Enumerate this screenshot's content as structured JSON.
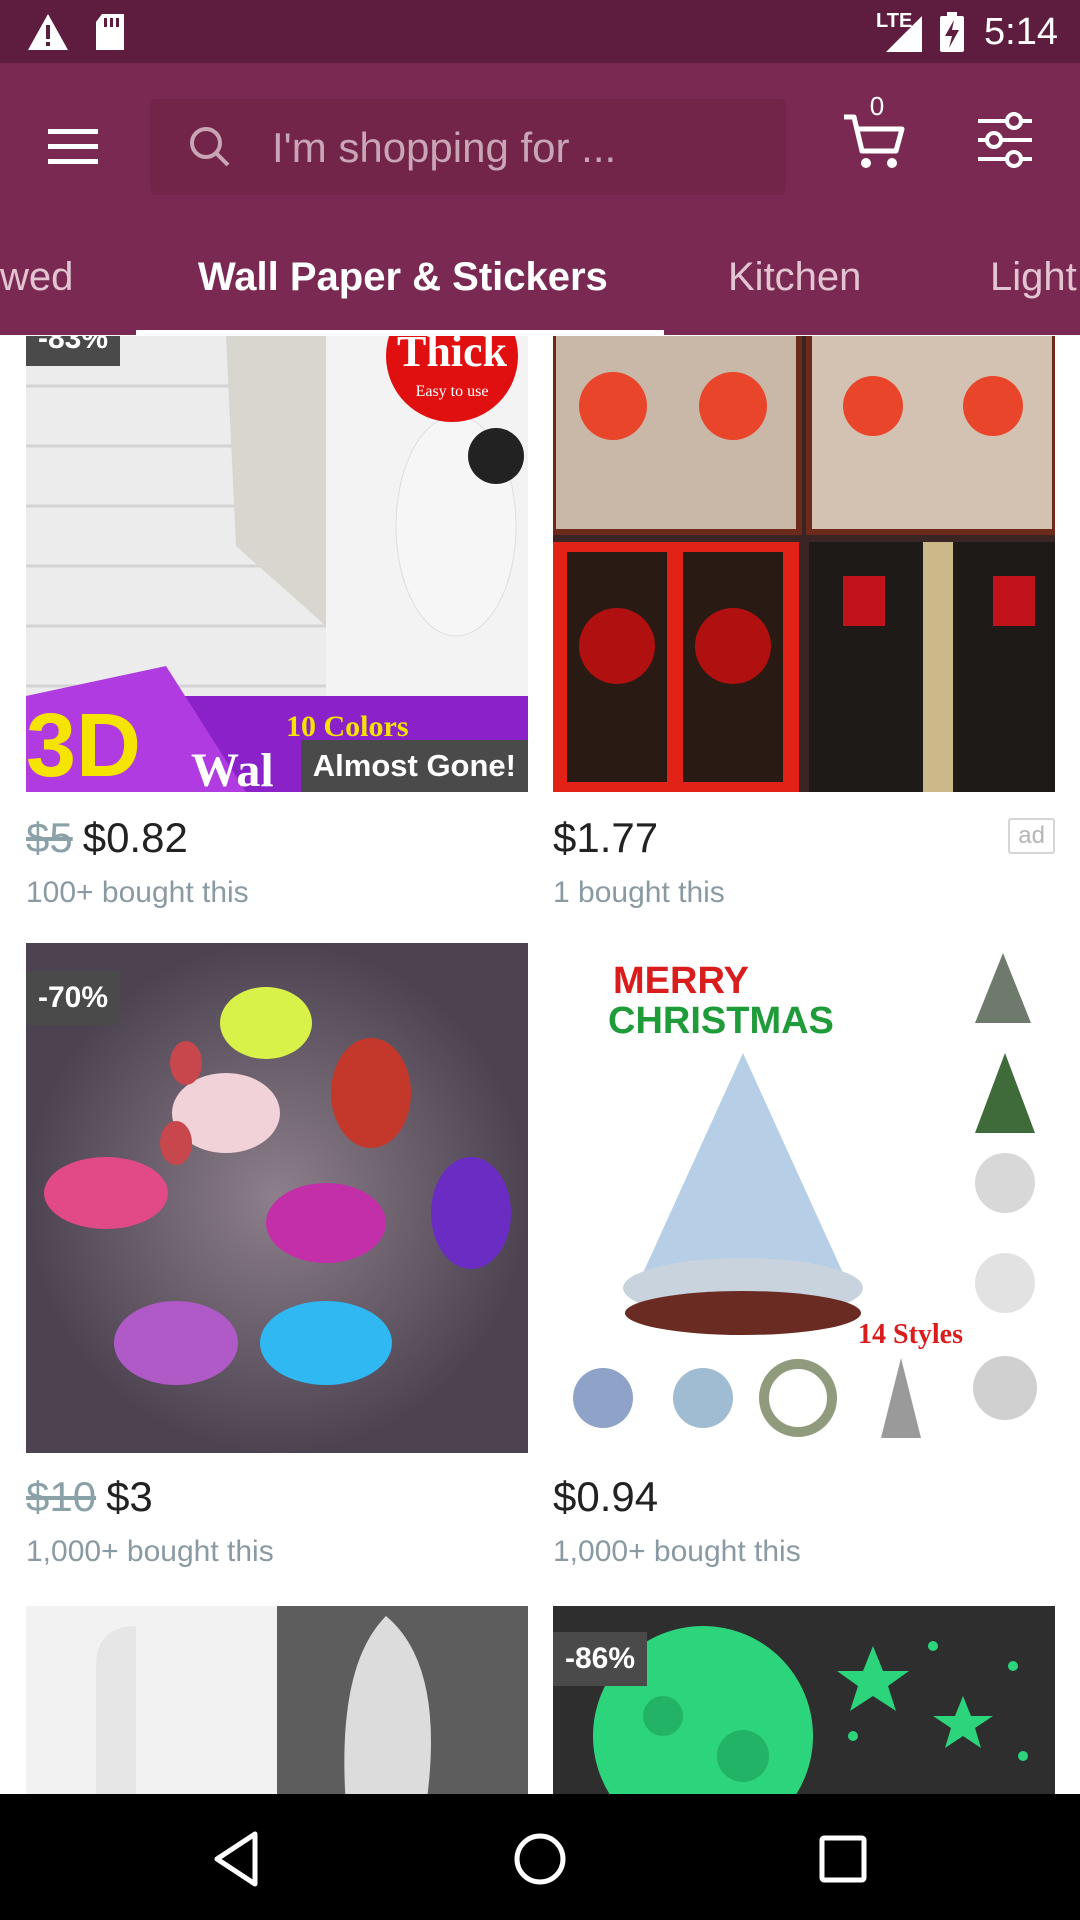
{
  "status_bar": {
    "time": "5:14",
    "network": "LTE",
    "icons": [
      "alert-icon",
      "sd-card-icon",
      "signal-icon",
      "battery-charging-icon"
    ]
  },
  "header": {
    "search_placeholder": "I'm shopping for ...",
    "cart_count": "0"
  },
  "tabs": [
    {
      "label": "wed"
    },
    {
      "label": "Wall Paper & Stickers",
      "active": true
    },
    {
      "label": "Kitchen"
    },
    {
      "label": "Light"
    }
  ],
  "products": [
    {
      "discount": "-83%",
      "badge": "Almost Gone!",
      "old_price": "$5",
      "price": "$0.82",
      "bought": "100+ bought this",
      "image_text": [
        "Thick",
        "Easy to use",
        "3D",
        "Wal",
        "10 Colors"
      ]
    },
    {
      "price": "$1.77",
      "bought": "1 bought this",
      "ad": "ad"
    },
    {
      "discount": "-70%",
      "old_price": "$10",
      "price": "$3",
      "bought": "1,000+ bought this"
    },
    {
      "price": "$0.94",
      "bought": "1,000+ bought this",
      "image_text": [
        "MERRY",
        "CHRISTMAS",
        "14 Styles"
      ]
    },
    {},
    {
      "discount": "-86%"
    }
  ],
  "colors": {
    "status_bar": "#5e1d3f",
    "app_bar": "#7a2a52",
    "search_bg": "#732449",
    "badge_bg": "#4a4a4a",
    "nav_bar": "#000000"
  }
}
